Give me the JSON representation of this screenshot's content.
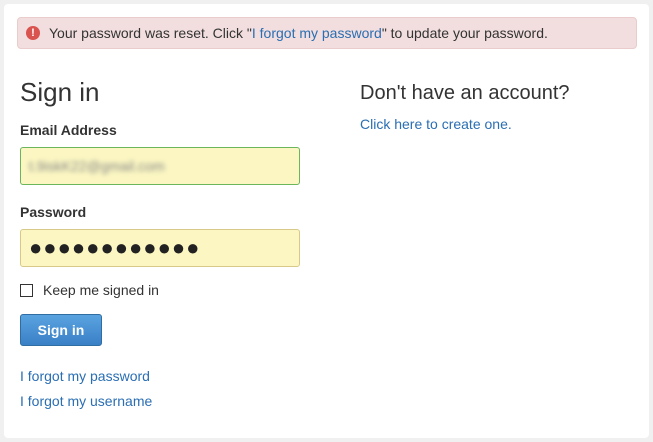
{
  "alert": {
    "icon": "exclamation-circle-icon",
    "text_before": "Your password was reset. Click \"",
    "link_text": "I forgot my password",
    "text_after": "\" to update your password."
  },
  "signin": {
    "heading": "Sign in",
    "email_label": "Email Address",
    "email_value": "t.9iskK22@gmail.com",
    "password_label": "Password",
    "password_value": "●●●●●●●●●●●●",
    "keep_signed_in_label": "Keep me signed in",
    "keep_signed_in_checked": false,
    "button_label": "Sign in",
    "forgot_password": "I forgot my password",
    "forgot_username": "I forgot my username"
  },
  "register": {
    "heading": "Don't have an account?",
    "link_text": "Click here to create one."
  },
  "colors": {
    "alert_bg": "#f2dede",
    "alert_icon": "#d9534f",
    "link": "#2a6eb3",
    "autofill_bg": "#fbf6c2",
    "button": "#3980c6"
  }
}
